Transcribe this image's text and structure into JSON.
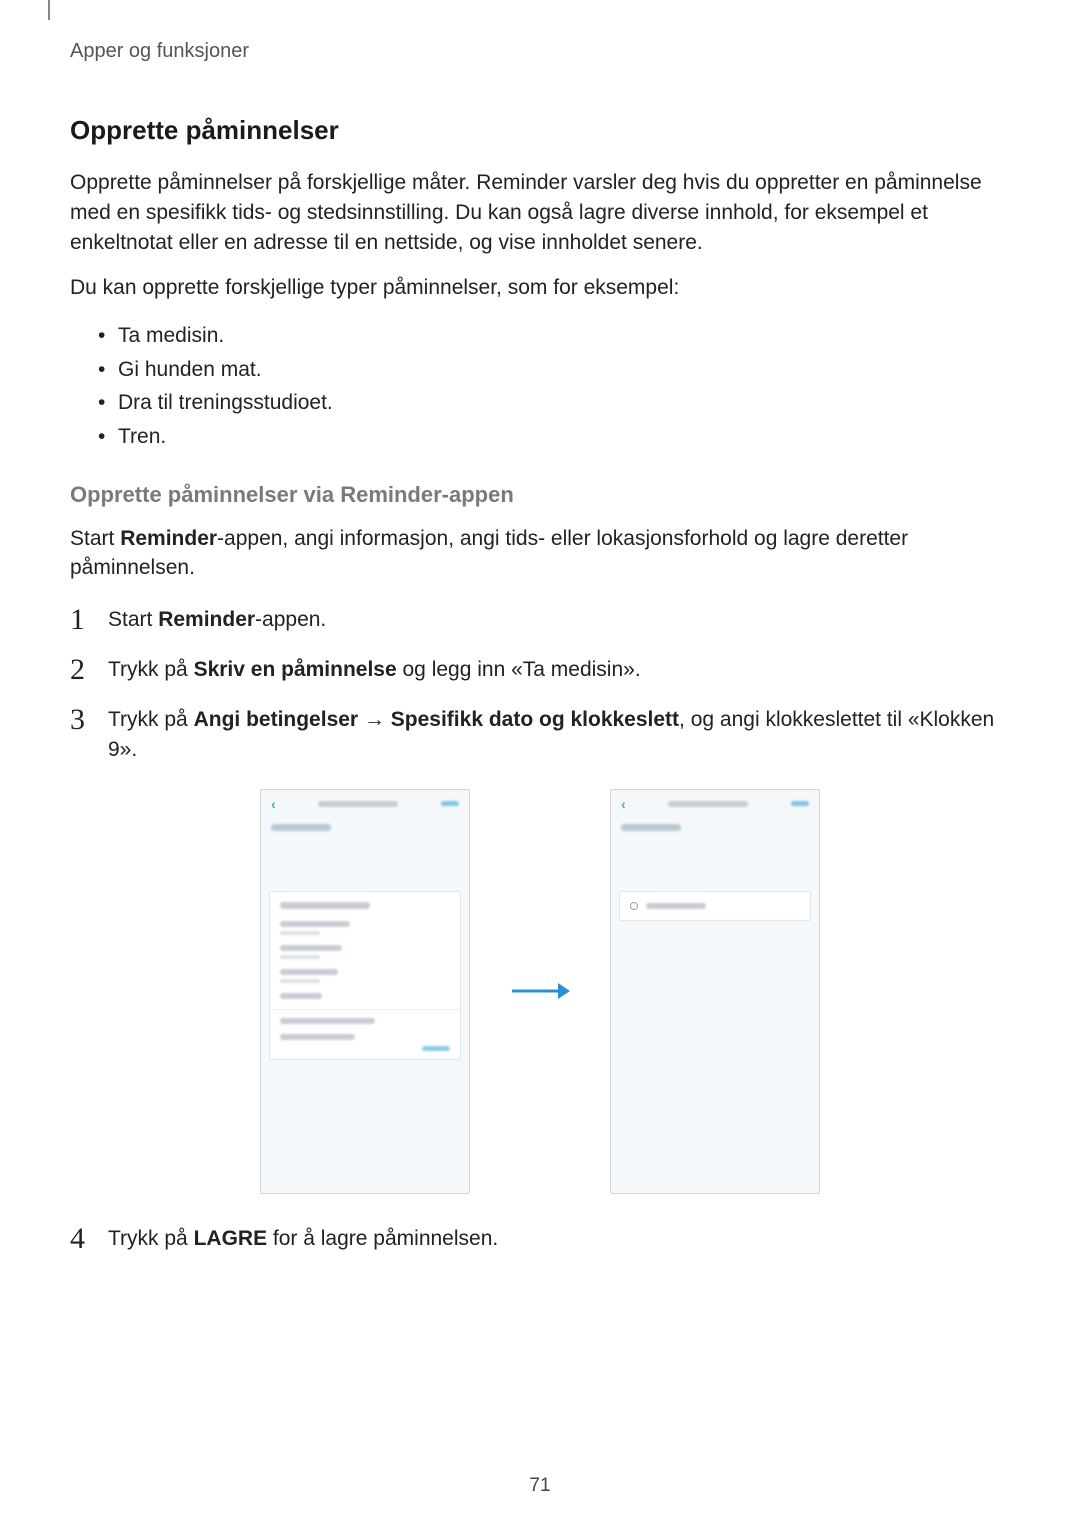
{
  "breadcrumb": "Apper og funksjoner",
  "section_title": "Opprette påminnelser",
  "para1": "Opprette påminnelser på forskjellige måter. Reminder varsler deg hvis du oppretter en påminnelse med en spesifikk tids- og stedsinnstilling. Du kan også lagre diverse innhold, for eksempel et enkeltnotat eller en adresse til en nettside, og vise innholdet senere.",
  "para2": "Du kan opprette forskjellige typer påminnelser, som for eksempel:",
  "bullets": [
    "Ta medisin.",
    "Gi hunden mat.",
    "Dra til treningsstudioet.",
    "Tren."
  ],
  "subsection_title": "Opprette påminnelser via Reminder-appen",
  "subsection_intro_pre": "Start ",
  "subsection_intro_bold": "Reminder",
  "subsection_intro_post": "-appen, angi informasjon, angi tids- eller lokasjonsforhold og lagre deretter påminnelsen.",
  "steps": {
    "s1_num": "1",
    "s1_pre": "Start ",
    "s1_bold": "Reminder",
    "s1_post": "-appen.",
    "s2_num": "2",
    "s2_pre": "Trykk på ",
    "s2_bold": "Skriv en påminnelse",
    "s2_post": " og legg inn «Ta medisin».",
    "s3_num": "3",
    "s3_pre": "Trykk på ",
    "s3_bold1": "Angi betingelser",
    "s3_arrow": " → ",
    "s3_bold2": "Spesifikk dato og klokkeslett",
    "s3_post": ", og angi klokkeslettet til «Klokken 9».",
    "s4_num": "4",
    "s4_pre": "Trykk på ",
    "s4_bold": "LAGRE",
    "s4_post": " for å lagre påminnelsen."
  },
  "page_number": "71"
}
